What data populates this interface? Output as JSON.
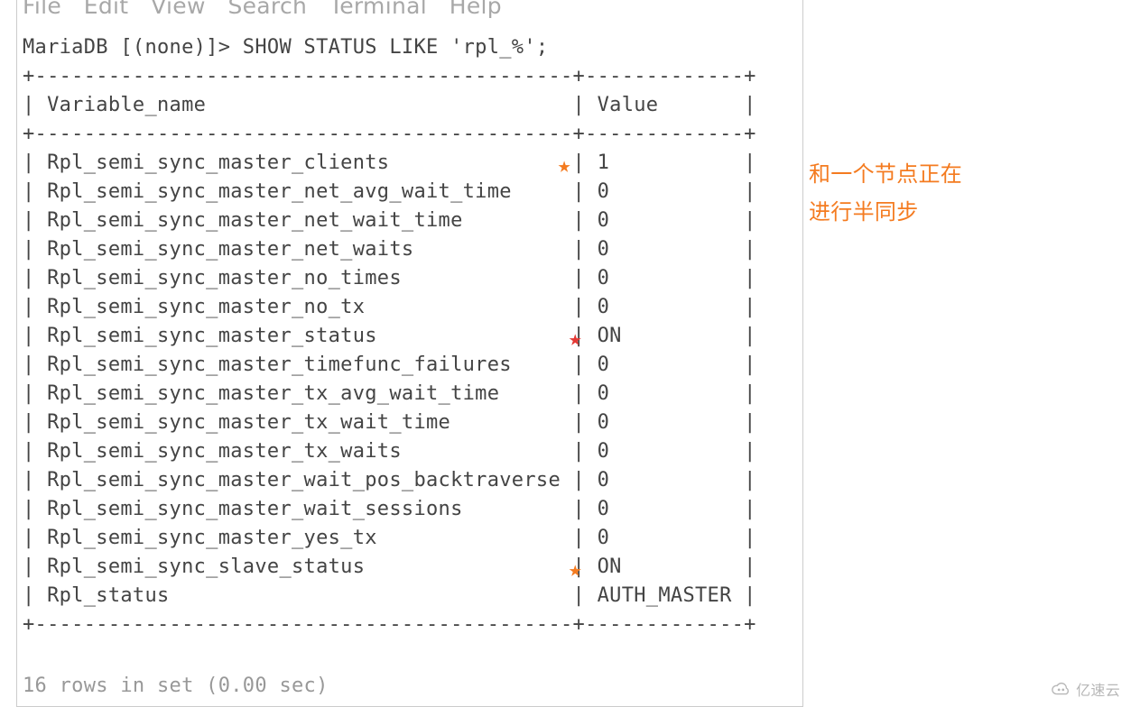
{
  "menubar": {
    "file": "File",
    "edit": "Edit",
    "view": "View",
    "search": "Search",
    "terminal": "Terminal",
    "help": "Help"
  },
  "terminal": {
    "prompt": "MariaDB [(none)]> ",
    "command": "SHOW STATUS LIKE 'rpl_%';",
    "sep_top": "+--------------------------------------------+-------------+",
    "header": "| Variable_name                              | Value       |",
    "sep_mid": "+--------------------------------------------+-------------+",
    "sep_bot": "+--------------------------------------------+-------------+",
    "rows": [
      {
        "name": "Rpl_semi_sync_master_clients",
        "value": "1",
        "star": "orange"
      },
      {
        "name": "Rpl_semi_sync_master_net_avg_wait_time",
        "value": "0",
        "star": ""
      },
      {
        "name": "Rpl_semi_sync_master_net_wait_time",
        "value": "0",
        "star": ""
      },
      {
        "name": "Rpl_semi_sync_master_net_waits",
        "value": "0",
        "star": ""
      },
      {
        "name": "Rpl_semi_sync_master_no_times",
        "value": "0",
        "star": ""
      },
      {
        "name": "Rpl_semi_sync_master_no_tx",
        "value": "0",
        "star": ""
      },
      {
        "name": "Rpl_semi_sync_master_status",
        "value": "ON",
        "star": "red"
      },
      {
        "name": "Rpl_semi_sync_master_timefunc_failures",
        "value": "0",
        "star": ""
      },
      {
        "name": "Rpl_semi_sync_master_tx_avg_wait_time",
        "value": "0",
        "star": ""
      },
      {
        "name": "Rpl_semi_sync_master_tx_wait_time",
        "value": "0",
        "star": ""
      },
      {
        "name": "Rpl_semi_sync_master_tx_waits",
        "value": "0",
        "star": ""
      },
      {
        "name": "Rpl_semi_sync_master_wait_pos_backtraverse",
        "value": "0",
        "star": ""
      },
      {
        "name": "Rpl_semi_sync_master_wait_sessions",
        "value": "0",
        "star": ""
      },
      {
        "name": "Rpl_semi_sync_master_yes_tx",
        "value": "0",
        "star": ""
      },
      {
        "name": "Rpl_semi_sync_slave_status",
        "value": "ON",
        "star": "orange"
      },
      {
        "name": "Rpl_status",
        "value": "AUTH_MASTER",
        "star": ""
      }
    ],
    "footer": "16 rows in set (0.00 sec)"
  },
  "annotation": {
    "line1": "和一个节点正在",
    "line2": "进行半同步"
  },
  "watermark": {
    "text": "亿速云"
  }
}
